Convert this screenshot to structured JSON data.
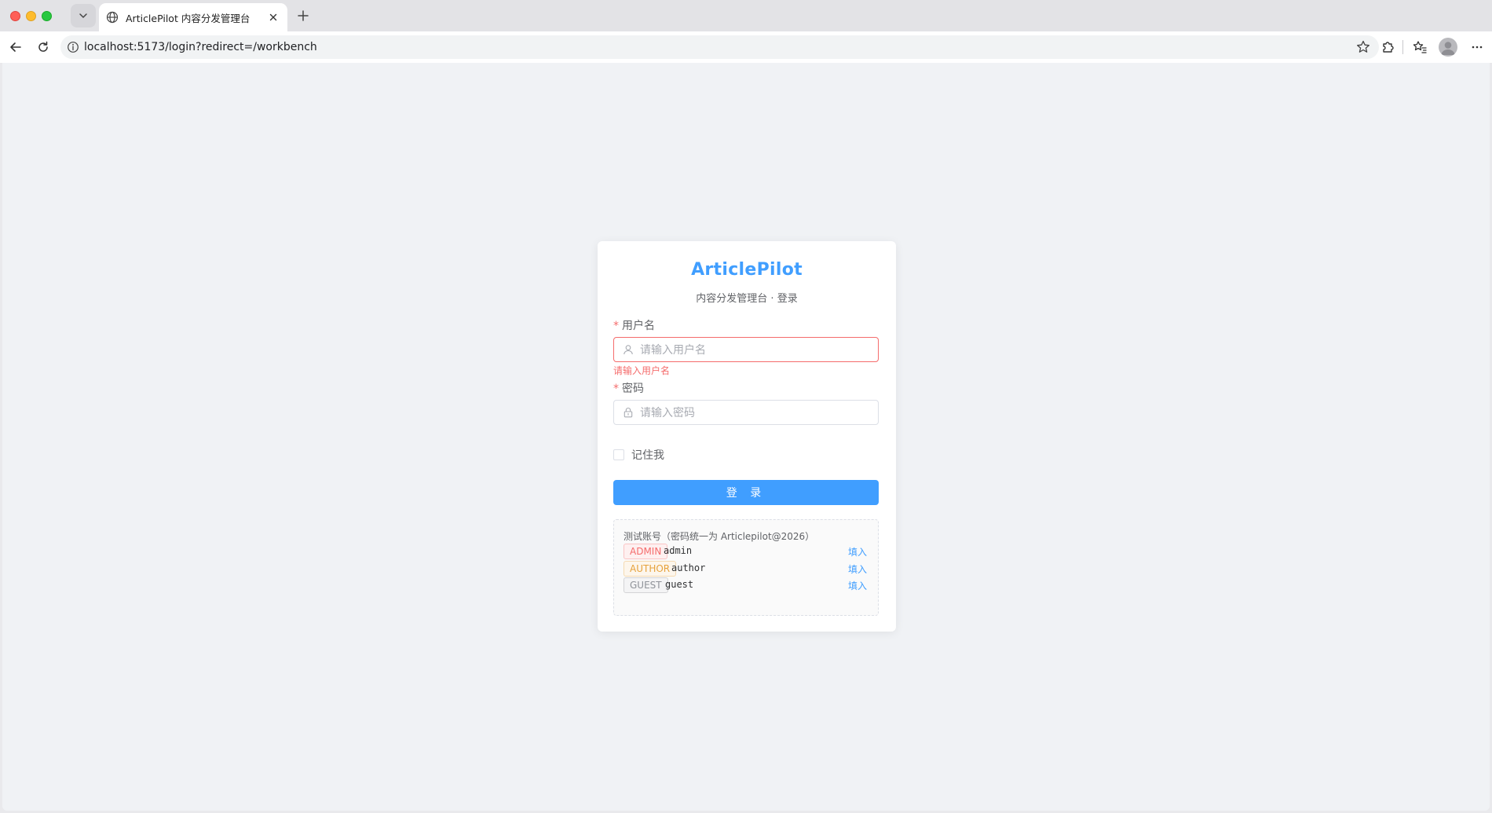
{
  "browser": {
    "tab_title": "ArticlePilot 内容分发管理台",
    "url": "localhost:5173/login?redirect=/workbench"
  },
  "login": {
    "brand": "ArticlePilot",
    "subtitle": "内容分发管理台 · 登录",
    "username": {
      "required_mark": "*",
      "label": "用户名",
      "placeholder": "请输入用户名",
      "value": "",
      "error": "请输入用户名"
    },
    "password": {
      "required_mark": "*",
      "label": "密码",
      "placeholder": "请输入密码",
      "value": ""
    },
    "remember_me": {
      "label": "记住我",
      "checked": false
    },
    "submit_label": "登 录",
    "test_accounts": {
      "title": "测试账号（密码统一为 Articlepilot@2026）",
      "fill_label": "填入",
      "rows": [
        {
          "role": "ADMIN",
          "username": "admin"
        },
        {
          "role": "AUTHOR",
          "username": "author"
        },
        {
          "role": "GUEST",
          "username": "guest"
        }
      ]
    }
  },
  "colors": {
    "primary": "#409eff",
    "danger": "#f56c6c",
    "warning": "#e6a23c",
    "info": "#909399",
    "page_background": "#f0f2f5"
  }
}
